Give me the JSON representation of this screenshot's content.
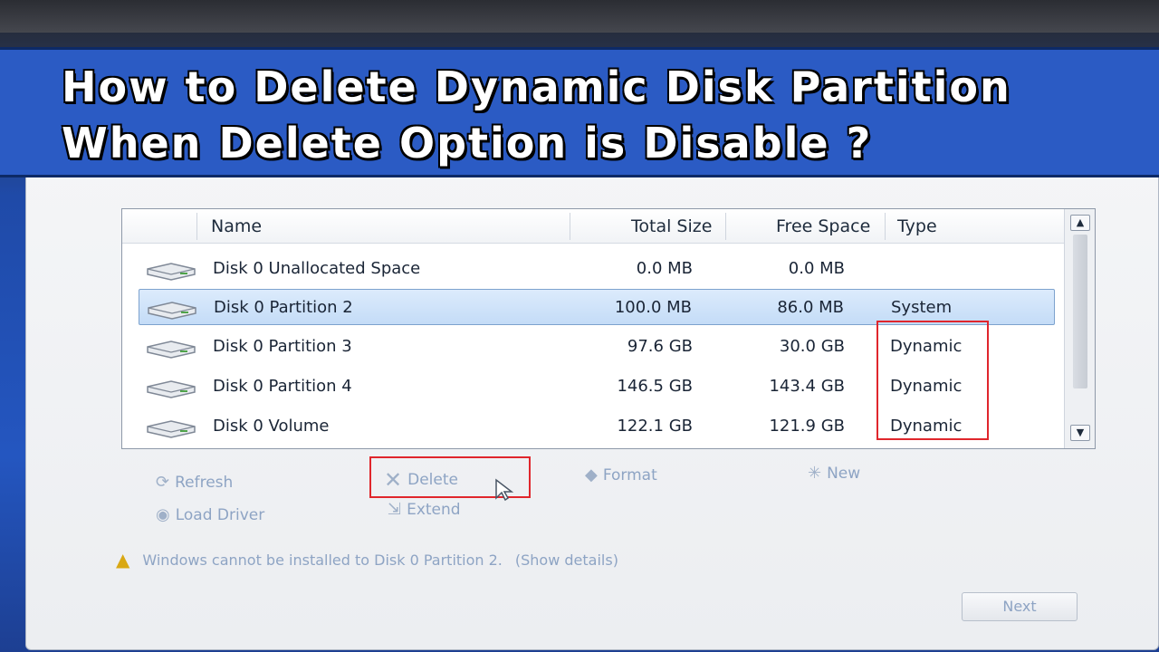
{
  "banner": {
    "line1": "How to Delete Dynamic Disk Partition",
    "line2": "When Delete Option is Disable ?"
  },
  "table": {
    "columns": {
      "name": "Name",
      "total": "Total Size",
      "free": "Free Space",
      "type": "Type"
    },
    "rows": [
      {
        "name": "Disk 0 Unallocated Space",
        "total": "0.0 MB",
        "free": "0.0 MB",
        "type": "",
        "selected": false
      },
      {
        "name": "Disk 0 Partition 2",
        "total": "100.0 MB",
        "free": "86.0 MB",
        "type": "System",
        "selected": true
      },
      {
        "name": "Disk 0 Partition 3",
        "total": "97.6 GB",
        "free": "30.0 GB",
        "type": "Dynamic",
        "selected": false
      },
      {
        "name": "Disk 0 Partition 4",
        "total": "146.5 GB",
        "free": "143.4 GB",
        "type": "Dynamic",
        "selected": false
      },
      {
        "name": "Disk 0 Volume",
        "total": "122.1 GB",
        "free": "121.9 GB",
        "type": "Dynamic",
        "selected": false
      }
    ]
  },
  "actions": {
    "refresh": "Refresh",
    "delete": "Delete",
    "format": "Format",
    "new": "New",
    "load_driver": "Load Driver",
    "extend": "Extend"
  },
  "warning": {
    "text": "Windows cannot be installed to Disk 0 Partition 2.",
    "link": "(Show details)"
  },
  "next_label": "Next",
  "colors": {
    "banner": "#2b5bc4",
    "highlight_box": "#e0262c",
    "selected_row": "#c4dcf7",
    "disabled_text": "#8ea4c4"
  },
  "icons": {
    "disk": "hard-disk-icon",
    "refresh": "refresh-icon",
    "delete": "delete-x-icon",
    "format": "format-eraser-icon",
    "new": "new-sparkle-icon",
    "load_driver": "load-driver-disc-icon",
    "extend": "extend-icon",
    "warning": "warning-triangle-icon",
    "cursor": "mouse-cursor-icon"
  }
}
